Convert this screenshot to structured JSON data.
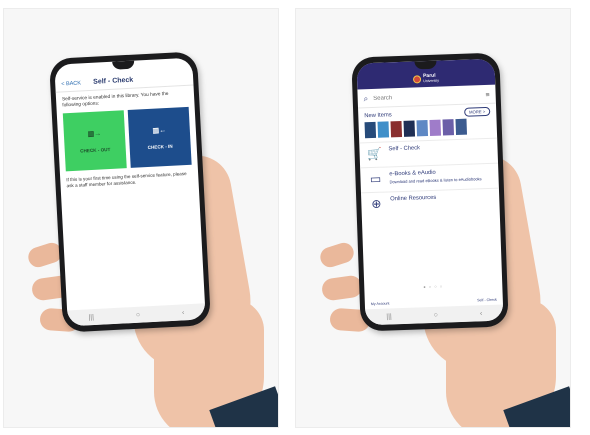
{
  "left_screen": {
    "back_label": "< BACK",
    "title": "Self - Check",
    "intro": "Self-service is enabled in this library. You have the following options:",
    "check_out_label": "CHECK - OUT",
    "check_in_label": "CHECK - IN",
    "footer": "If this is your first time using the self-service feature, please ask a staff member for assistance."
  },
  "right_screen": {
    "brand_name": "Parul",
    "brand_sub": "University",
    "search_placeholder": "Search",
    "new_items_title": "New Items",
    "more_label": "MORE >",
    "book_colors": [
      "#274b7a",
      "#3f8fc9",
      "#8a2f2f",
      "#1f2f55",
      "#5e88c4",
      "#9f7cc9",
      "#6b5fa8",
      "#3c5b8f"
    ],
    "items": [
      {
        "title": "Self - Check",
        "subtitle": "",
        "icon": "cart-icon"
      },
      {
        "title": "e-Books & eAudio",
        "subtitle": "Download and read eBooks & listen to eAudiobooks",
        "icon": "tablet-icon"
      },
      {
        "title": "Online Resources",
        "subtitle": "",
        "icon": "globe-icon"
      }
    ],
    "bottom_left": "My Account",
    "bottom_right": "Self - Check"
  }
}
